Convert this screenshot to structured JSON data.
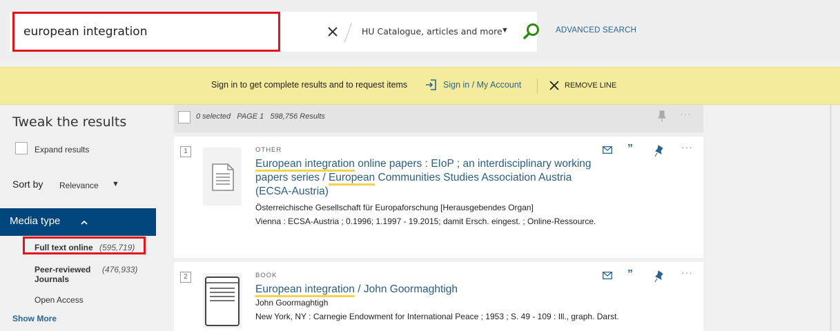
{
  "search": {
    "query": "european integration",
    "scope": "HU Catalogue, articles and more",
    "advanced_label": "ADVANCED SEARCH"
  },
  "banner": {
    "message": "Sign in to get complete results and to request items",
    "signin_label": "Sign in / My Account",
    "remove_label": "REMOVE LINE"
  },
  "sidebar": {
    "title": "Tweak the results",
    "expand_label": "Expand results",
    "sort_label": "Sort by",
    "sort_value": "Relevance",
    "media_title": "Media type",
    "facets": [
      {
        "label": "Full text online",
        "count": "(595,719)"
      },
      {
        "label": "Peer-reviewed Journals",
        "label1": "Peer-reviewed",
        "label2": "Journals",
        "count": "(476,933)"
      },
      {
        "label": "Open Access"
      }
    ],
    "show_more": "Show More"
  },
  "results_header": {
    "selected": "0 selected",
    "page": "PAGE 1",
    "count": "598,756 Results"
  },
  "results": [
    {
      "rank": "1",
      "type": "OTHER",
      "title_parts": [
        "European integration",
        " online papers : EIoP ; an interdisciplinary working papers series / ",
        "European",
        " Communities Studies Association Austria (ECSA-Austria)"
      ],
      "line1": "Österreichische Gesellschaft für Europaforschung [Herausgebendes Organ]",
      "line2": "Vienna : ECSA-Austria ; 0.1996; 1.1997 - 19.2015; damit Ersch. eingest. ; Online-Ressource."
    },
    {
      "rank": "2",
      "type": "BOOK",
      "title_parts": [
        "European integration",
        " / John Goormaghtigh"
      ],
      "line1": "John Goormaghtigh",
      "line2": "New York, NY : Carnegie Endowment for International Peace ; 1953 ; S. 49 - 109 : Ill., graph. Darst."
    }
  ],
  "icons": {
    "clear": "close-icon",
    "search": "search-icon",
    "signin": "sign-in-icon",
    "remove": "close-icon",
    "mail": "email-icon",
    "quote": "citation-icon",
    "pin": "pin-icon",
    "more": "more-icon"
  },
  "colors": {
    "accent": "#29658e",
    "banner": "#f4ec9c",
    "media_header": "#00457c",
    "highlight_box": "#e3131b",
    "search_green": "#2d8a12",
    "title_underline": "#f5d44c"
  }
}
